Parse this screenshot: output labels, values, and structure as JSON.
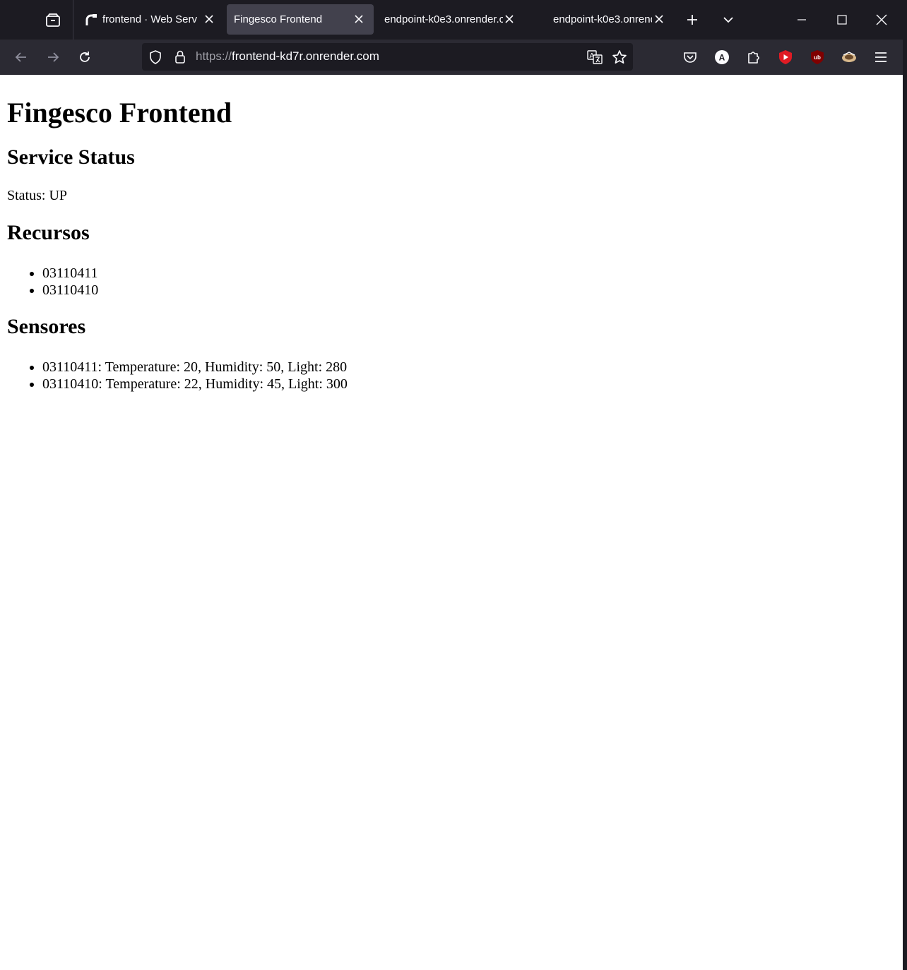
{
  "browser": {
    "tabs": [
      {
        "title": "frontend · Web Serv",
        "active": false
      },
      {
        "title": "Fingesco Frontend",
        "active": true
      },
      {
        "title": "endpoint-k0e3.onrender.c",
        "active": false
      },
      {
        "title": "endpoint-k0e3.onrend",
        "active": false
      }
    ],
    "url_protocol": "https://",
    "url_host": "frontend-kd7r.onrender.com",
    "icons": {
      "tab_list": "firefox-view-icon",
      "new_tab": "plus-icon",
      "list_all_tabs": "chevron-down-icon",
      "minimize": "minimize-icon",
      "maximize": "maximize-icon",
      "close": "close-icon",
      "back": "back-arrow-icon",
      "forward": "forward-arrow-icon",
      "reload": "reload-icon",
      "tracking": "shield-icon",
      "lock": "lock-icon",
      "translate": "translate-icon",
      "bookmark": "star-icon",
      "pocket": "pocket-icon",
      "account": "account-icon",
      "extensions": "puzzle-icon",
      "ext_youtube": "youtube-extension-icon",
      "ext_ublock": "ublock-icon",
      "ext_other": "extension-icon",
      "menu": "hamburger-menu-icon"
    },
    "extension_labels": {
      "account": "A",
      "ublock": "ub"
    }
  },
  "page": {
    "title": "Fingesco Frontend",
    "service_status": {
      "heading": "Service Status",
      "text": "Status: UP"
    },
    "recursos": {
      "heading": "Recursos",
      "items": [
        "03110411",
        "03110410"
      ]
    },
    "sensores": {
      "heading": "Sensores",
      "items": [
        "03110411: Temperature: 20, Humidity: 50, Light: 280",
        "03110410: Temperature: 22, Humidity: 45, Light: 300"
      ]
    }
  },
  "colors": {
    "tabbar_bg": "#1c1b22",
    "navbar_bg": "#2b2a33",
    "active_tab_bg": "#42414d",
    "page_bg": "#ffffff"
  }
}
